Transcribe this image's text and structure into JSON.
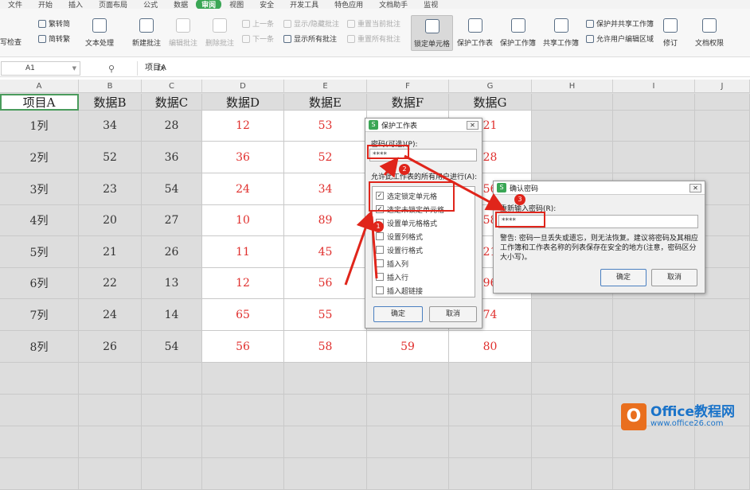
{
  "menu": [
    "文件",
    "开始",
    "插入",
    "页面布局",
    "公式",
    "数据",
    "审阅",
    "视图",
    "安全",
    "开发工具",
    "特色应用",
    "文档助手",
    "监视"
  ],
  "ribbon": {
    "spell": "写检查",
    "trad": "繁转简",
    "simp": "简转繁",
    "text": "文本处理",
    "new_comment": "新建批注",
    "edit_comment": "编辑批注",
    "del_comment": "删除批注",
    "prev": "上一条",
    "next": "下一条",
    "show_hide": "显示/隐藏批注",
    "show_all": "显示所有批注",
    "reset_cur": "重置当前批注",
    "reset_all": "重置所有批注",
    "lock_cells": "锁定单元格",
    "protect_sheet": "保护工作表",
    "protect_book": "保护工作簿",
    "share_book": "共享工作簿",
    "protect_share": "保护并共享工作簿",
    "allow_edit": "允许用户编辑区域",
    "revise": "修订",
    "doc_perm": "文档权限"
  },
  "formula_bar": {
    "cell_ref": "A1",
    "fx": "fx",
    "value": "项目A"
  },
  "columns": [
    "A",
    "B",
    "C",
    "D",
    "E",
    "F",
    "G",
    "H",
    "I",
    "J"
  ],
  "headers": [
    "项目A",
    "数据B",
    "数据C",
    "数据D",
    "数据E",
    "数据F",
    "数据G"
  ],
  "rows": [
    [
      "1列",
      "34",
      "28",
      "12",
      "53",
      "",
      "21"
    ],
    [
      "2列",
      "52",
      "36",
      "36",
      "52",
      "",
      "28"
    ],
    [
      "3列",
      "23",
      "54",
      "24",
      "34",
      "",
      "56"
    ],
    [
      "4列",
      "20",
      "27",
      "10",
      "89",
      "",
      "58"
    ],
    [
      "5列",
      "21",
      "26",
      "11",
      "45",
      "",
      "21"
    ],
    [
      "6列",
      "22",
      "13",
      "12",
      "56",
      "",
      "96"
    ],
    [
      "7列",
      "24",
      "14",
      "65",
      "55",
      "72",
      "74"
    ],
    [
      "8列",
      "26",
      "54",
      "56",
      "58",
      "59",
      "80"
    ]
  ],
  "protect_dialog": {
    "title": "保护工作表",
    "password_label": "密码(可选)(P):",
    "password_value": "****",
    "allow_label": "允许此工作表的所有用户进行(A):",
    "items": [
      {
        "label": "选定锁定单元格",
        "checked": true
      },
      {
        "label": "选定未锁定单元格",
        "checked": true
      },
      {
        "label": "设置单元格格式",
        "checked": false
      },
      {
        "label": "设置列格式",
        "checked": false
      },
      {
        "label": "设置行格式",
        "checked": false
      },
      {
        "label": "插入列",
        "checked": false
      },
      {
        "label": "插入行",
        "checked": false
      },
      {
        "label": "插入超链接",
        "checked": false
      }
    ],
    "ok": "确定",
    "cancel": "取消"
  },
  "confirm_dialog": {
    "title": "确认密码",
    "reenter_label": "重新输入密码(R):",
    "password_value": "****",
    "warning": "警告: 密码一旦丢失或遗忘，则无法恢复。建议将密码及其相应工作簿和工作表名称的列表保存在安全的地方(注意，密码区分大小写)。",
    "ok": "确定",
    "cancel": "取消"
  },
  "badges": [
    "1",
    "2",
    "3"
  ],
  "watermark": {
    "title": "Office教程网",
    "url": "www.office26.com",
    "letter": "O"
  },
  "colors": {
    "accent": "#3aa655",
    "red": "#e0251b",
    "data_red": "#e0302e"
  }
}
